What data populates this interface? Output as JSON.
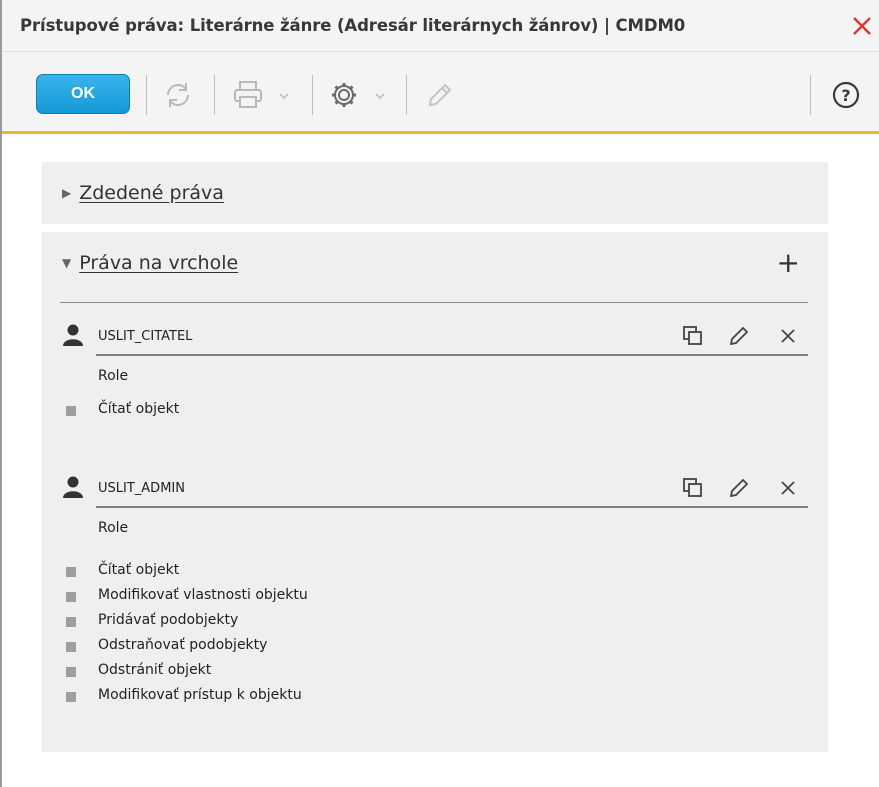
{
  "window": {
    "title": "Prístupové práva: Literárne žánre (Adresár literárnych žánrov) | CMDM0"
  },
  "toolbar": {
    "ok_label": "OK",
    "icons": [
      "refresh-icon",
      "print-icon",
      "settings-icon",
      "edit-icon",
      "help-icon"
    ]
  },
  "inherited": {
    "label": "Zdedené práva"
  },
  "top_rights": {
    "label": "Práva na vrchole",
    "add_symbol": "+",
    "entries": [
      {
        "name": "USLIT_CITATEL",
        "type": "Role",
        "permissions": [
          "Čítať objekt"
        ]
      },
      {
        "name": "USLIT_ADMIN",
        "type": "Role",
        "permissions": [
          "Čítať objekt",
          "Modifikovať vlastnosti objektu",
          "Pridávať podobjekty",
          "Odstraňovať podobjekty",
          "Odstrániť objekt",
          "Modifikovať prístup k objektu"
        ]
      }
    ]
  },
  "colors": {
    "accent_bar": "#e8b830",
    "ok_button": "#139ad9",
    "close": "#e0352b",
    "panel_bg": "#efefef"
  }
}
